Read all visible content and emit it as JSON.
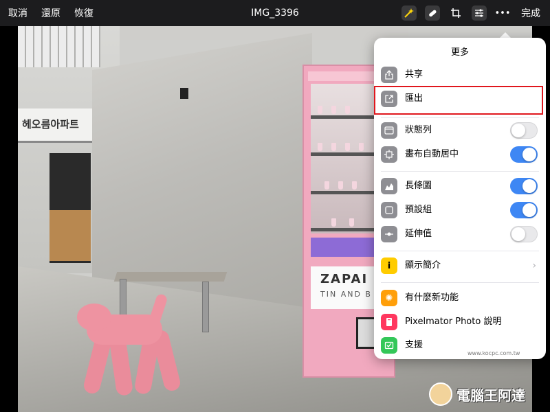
{
  "toolbar": {
    "cancel": "取消",
    "undo": "還原",
    "redo": "恢復",
    "title": "IMG_3396",
    "done": "完成",
    "icons": [
      "ml-enhance-icon",
      "repair-icon",
      "crop-icon",
      "adjust-icon",
      "more-icon"
    ]
  },
  "photo": {
    "sign_text": "헤오름아파트",
    "vending_brand": "ZAPAI",
    "vending_sub": "TIN AND B"
  },
  "menu": {
    "title": "更多",
    "items": [
      {
        "label": "共享"
      },
      {
        "label": "匯出"
      },
      {
        "label": "狀態列",
        "toggle": false
      },
      {
        "label": "畫布自動居中",
        "toggle": true
      },
      {
        "label": "長條圖",
        "toggle": true
      },
      {
        "label": "預設組",
        "toggle": true
      },
      {
        "label": "延伸值",
        "toggle": false
      },
      {
        "label": "顯示簡介"
      },
      {
        "label": "有什麼新功能"
      },
      {
        "label": "Pixelmator Photo 說明"
      },
      {
        "label": "支援"
      }
    ]
  },
  "colors": {
    "toggle_on": "#3e87f4",
    "highlight": "#e0161d",
    "info_icon": "#ffcc00",
    "whatsnew_icon": "#ff9f0a",
    "help_icon": "#ff375f",
    "support_icon": "#34c759"
  },
  "watermark": {
    "text": "電腦王阿達",
    "url": "www.kocpc.com.tw"
  }
}
